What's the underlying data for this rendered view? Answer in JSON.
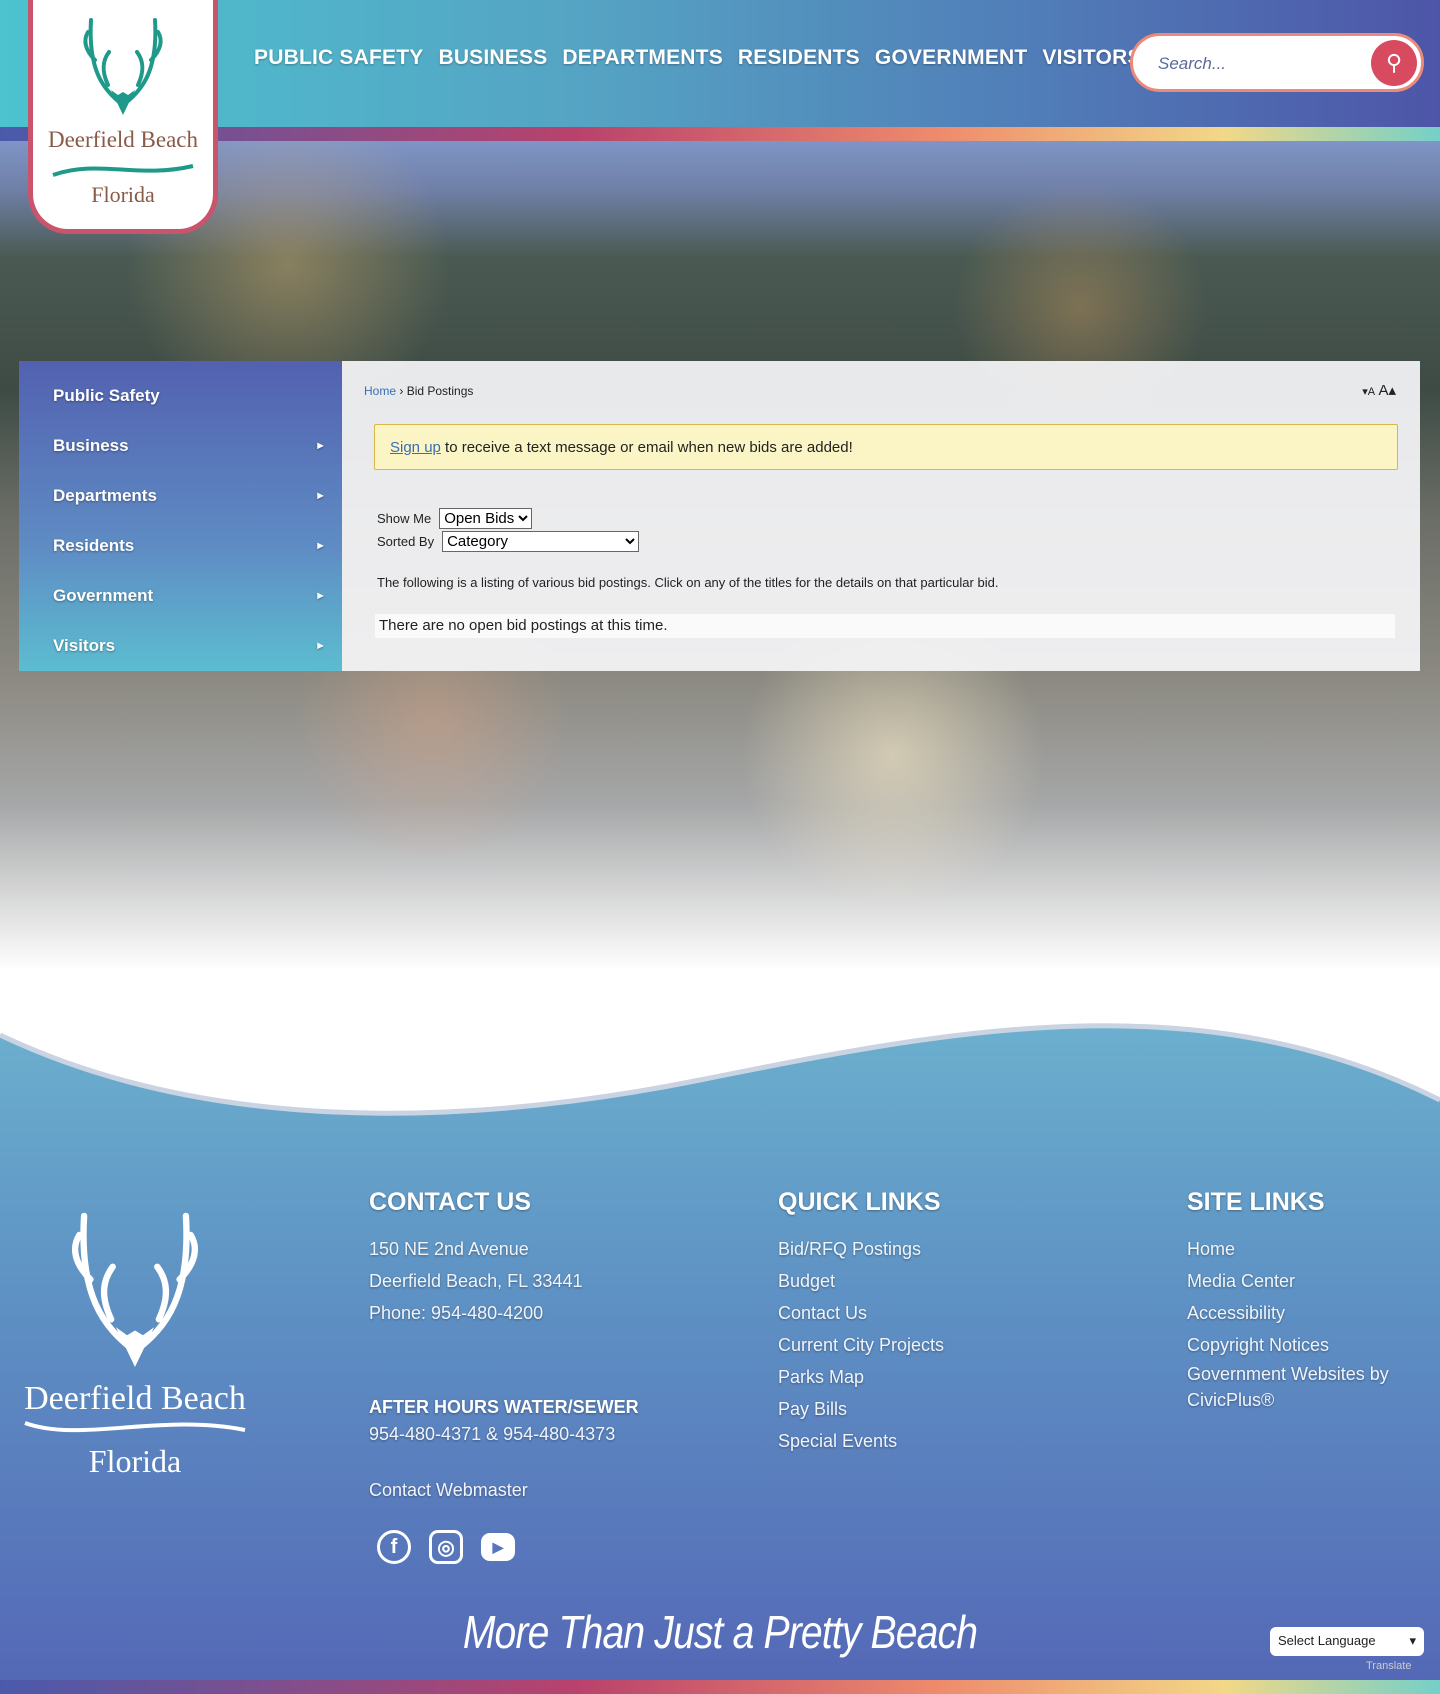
{
  "header": {
    "logo": {
      "line1": "Deerfield Beach",
      "line2": "Florida"
    },
    "nav": [
      "PUBLIC SAFETY",
      "BUSINESS",
      "DEPARTMENTS",
      "RESIDENTS",
      "GOVERNMENT",
      "VISITORS"
    ],
    "search_placeholder": "Search..."
  },
  "sidebar": {
    "items": [
      {
        "label": "Public Safety",
        "arrow": ""
      },
      {
        "label": "Business",
        "arrow": "►"
      },
      {
        "label": "Departments",
        "arrow": "►"
      },
      {
        "label": "Residents",
        "arrow": "►"
      },
      {
        "label": "Government",
        "arrow": "►"
      },
      {
        "label": "Visitors",
        "arrow": "►"
      }
    ]
  },
  "content": {
    "breadcrumb": {
      "home": "Home",
      "sep": "›",
      "current": "Bid Postings"
    },
    "font_decrease": "▾A",
    "font_increase": "A▴",
    "alert": {
      "link": "Sign up",
      "text": " to receive a text message or email when new bids are added!"
    },
    "show_me": {
      "label": "Show Me",
      "value": "Open Bids"
    },
    "sorted_by": {
      "label": "Sorted By",
      "value": "Category"
    },
    "description": "The following is a listing of various bid postings. Click on any of the titles for the details on that particular bid.",
    "empty": "There are no open bid postings at this time."
  },
  "footer": {
    "logo": {
      "line1": "Deerfield Beach",
      "line2": "Florida"
    },
    "contact": {
      "title": "CONTACT US",
      "address1": "150 NE 2nd Avenue",
      "address2": "Deerfield Beach, FL 33441",
      "phone": "Phone: 954-480-4200",
      "after_title": "AFTER HOURS WATER/SEWER",
      "after_phone": "954-480-4371 & 954-480-4373",
      "webmaster": "Contact Webmaster"
    },
    "quick": {
      "title": "QUICK LINKS",
      "links": [
        "Bid/RFQ Postings",
        "Budget",
        "Contact Us",
        "Current City Projects",
        "Parks Map",
        "Pay Bills",
        "Special Events"
      ]
    },
    "site": {
      "title": "SITE LINKS",
      "links": [
        "Home",
        "Media Center",
        "Accessibility",
        "Copyright Notices",
        "Government Websites by CivicPlus®"
      ]
    },
    "tagline": "More Than Just a Pretty Beach",
    "language": "Select Language",
    "translate": "Translate"
  }
}
